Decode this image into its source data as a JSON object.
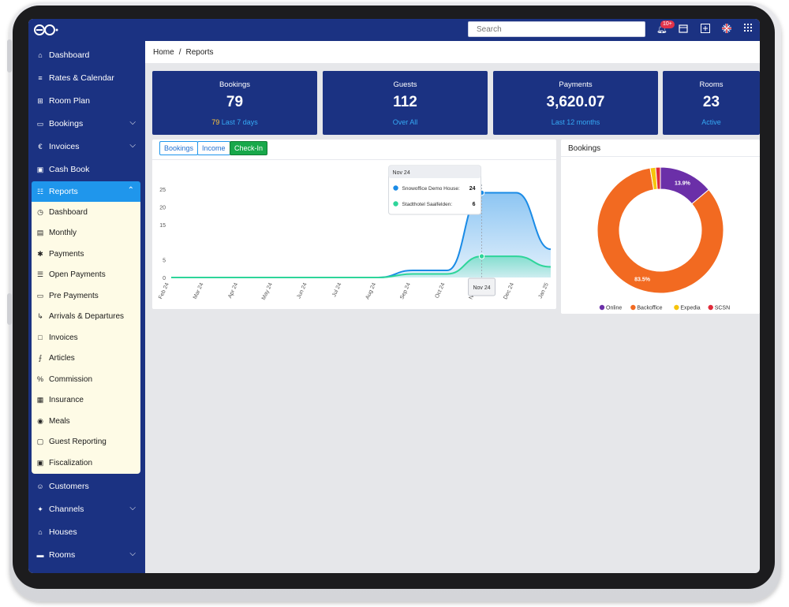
{
  "topbar": {
    "search_placeholder": "Search",
    "notification_count": "10+"
  },
  "sidebar": {
    "items_top": [
      {
        "label": "Dashboard",
        "icon": "home-icon"
      },
      {
        "label": "Rates & Calendar",
        "icon": "list-icon"
      },
      {
        "label": "Room Plan",
        "icon": "grid-icon"
      },
      {
        "label": "Bookings",
        "icon": "monitor-icon"
      },
      {
        "label": "Invoices",
        "icon": "euro-icon"
      },
      {
        "label": "Cash Book",
        "icon": "briefcase-icon"
      }
    ],
    "reports_label": "Reports",
    "reports_sub": [
      {
        "label": "Dashboard",
        "icon": "speedometer-icon"
      },
      {
        "label": "Monthly",
        "icon": "calendar-icon"
      },
      {
        "label": "Payments",
        "icon": "asterisk-icon"
      },
      {
        "label": "Open Payments",
        "icon": "file-list-icon"
      },
      {
        "label": "Pre Payments",
        "icon": "card-icon"
      },
      {
        "label": "Arrivals & Departures",
        "icon": "route-icon"
      },
      {
        "label": "Invoices",
        "icon": "folder-icon"
      },
      {
        "label": "Articles",
        "icon": "lines-icon"
      },
      {
        "label": "Commission",
        "icon": "percent-icon"
      },
      {
        "label": "Insurance",
        "icon": "checker-icon"
      },
      {
        "label": "Meals",
        "icon": "plate-icon"
      },
      {
        "label": "Guest Reporting",
        "icon": "bag-icon"
      },
      {
        "label": "Fiscalization",
        "icon": "cash-icon"
      }
    ],
    "items_bottom": [
      {
        "label": "Customers",
        "icon": "users-icon"
      },
      {
        "label": "Channels",
        "icon": "channels-icon"
      },
      {
        "label": "Houses",
        "icon": "houses-icon"
      },
      {
        "label": "Rooms",
        "icon": "bed-icon"
      }
    ]
  },
  "breadcrumb": {
    "home": "Home",
    "sep": "/",
    "current": "Reports"
  },
  "cards": [
    {
      "title": "Bookings",
      "value": "79",
      "sub_highlight": "79",
      "sub": "Last 7 days"
    },
    {
      "title": "Guests",
      "value": "112",
      "sub_highlight": "",
      "sub": "Over All"
    },
    {
      "title": "Payments",
      "value": "3,620.07",
      "sub_highlight": "",
      "sub": "Last 12 months"
    },
    {
      "title": "Rooms",
      "value": "23",
      "sub_highlight": "",
      "sub": "Active"
    }
  ],
  "tabs": [
    {
      "label": "Bookings",
      "active": false
    },
    {
      "label": "Income",
      "active": false
    },
    {
      "label": "Check-In",
      "active": true
    }
  ],
  "colors": {
    "navy": "#1b3282",
    "accent": "#1f96ec",
    "active_tab": "#18a84a",
    "series1": "#1a8be6",
    "series2": "#2ed59a"
  },
  "chart_data": [
    {
      "type": "area",
      "x": [
        "Feb 24",
        "Mar 24",
        "Apr 24",
        "May 24",
        "Jun 24",
        "Jul 24",
        "Aug 24",
        "Sep 24",
        "Oct 24",
        "Nov 24",
        "Dec 24",
        "Jan 25"
      ],
      "series": [
        {
          "name": "Snowoffice Demo House",
          "values": [
            0,
            0,
            0,
            0,
            0,
            0,
            0,
            2,
            2,
            24,
            24,
            8
          ]
        },
        {
          "name": "Stadthotel Saalfelden",
          "values": [
            0,
            0,
            0,
            0,
            0,
            0,
            0,
            1,
            1,
            6,
            6,
            3
          ]
        }
      ],
      "ylim": [
        0,
        25
      ],
      "yticks": [
        0,
        5,
        15,
        20,
        25
      ],
      "legend": "bottom",
      "tooltip": {
        "title": "Nov 24",
        "rows": [
          {
            "label": "Snowoffice Demo House:",
            "value": "24"
          },
          {
            "label": "Stadthotel Saalfelden:",
            "value": "6"
          }
        ]
      },
      "crosshair_label": "Nov 24"
    },
    {
      "type": "pie",
      "title": "Bookings",
      "donut": true,
      "labels": [
        "Online",
        "Backoffice",
        "Expedia",
        "SCSN"
      ],
      "values": [
        13.9,
        83.5,
        1.4,
        1.2
      ],
      "colors": [
        "#6b2fa8",
        "#f26a21",
        "#f6c40c",
        "#e02b3a"
      ],
      "data_labels": [
        "13.9%",
        "83.5%",
        "",
        ""
      ],
      "legend": "bottom"
    }
  ]
}
